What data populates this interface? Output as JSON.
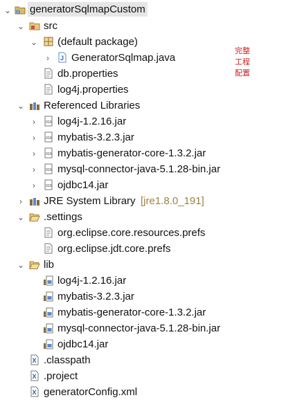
{
  "tree": {
    "root": "generatorSqlmapCustom",
    "src": "src",
    "default_package": "(default package)",
    "generator_java": "GeneratorSqlmap.java",
    "db_properties": "db.properties",
    "log4j_properties": "log4j.properties",
    "referenced_libraries": "Referenced Libraries",
    "ref_libs": [
      "log4j-1.2.16.jar",
      "mybatis-3.2.3.jar",
      "mybatis-generator-core-1.3.2.jar",
      "mysql-connector-java-5.1.28-bin.jar",
      "ojdbc14.jar"
    ],
    "jre_label": "JRE System Library",
    "jre_version": "[jre1.8.0_191]",
    "settings": ".settings",
    "settings_files": [
      "org.eclipse.core.resources.prefs",
      "org.eclipse.jdt.core.prefs"
    ],
    "lib": "lib",
    "lib_files": [
      "log4j-1.2.16.jar",
      "mybatis-3.2.3.jar",
      "mybatis-generator-core-1.3.2.jar",
      "mysql-connector-java-5.1.28-bin.jar",
      "ojdbc14.jar"
    ],
    "classpath": ".classpath",
    "project": ".project",
    "generator_config": "generatorConfig.xml"
  },
  "annotation": {
    "lines": [
      "完整",
      "工程",
      "配置"
    ],
    "color": "#d02020"
  },
  "colors": {
    "root_highlight": "#e6e6e6",
    "jre_decoration": "#a08040"
  }
}
